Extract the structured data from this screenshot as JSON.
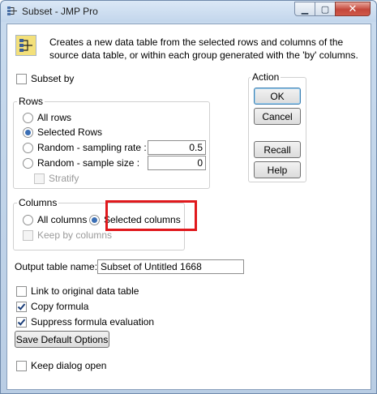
{
  "window": {
    "title": "Subset - JMP Pro",
    "minimize_glyph": "▁",
    "maximize_glyph": "▢",
    "close_glyph": "✕"
  },
  "info": {
    "text": "Creates a new data table from the selected rows and columns of the source data table, or within each group generated with the 'by' columns."
  },
  "subset_by": {
    "label": "Subset by",
    "checked": false
  },
  "rows": {
    "legend": "Rows",
    "all_rows": "All rows",
    "selected_rows": "Selected Rows",
    "random_rate": "Random - sampling rate :",
    "random_rate_value": "0.5",
    "random_size": "Random - sample size :",
    "random_size_value": "0",
    "stratify": "Stratify",
    "selected": "selected_rows"
  },
  "columns": {
    "legend": "Columns",
    "all_columns": "All columns",
    "selected_columns": "Selected columns",
    "keep_by_columns": "Keep by columns",
    "selected": "selected_columns"
  },
  "action": {
    "legend": "Action",
    "ok": "OK",
    "cancel": "Cancel",
    "recall": "Recall",
    "help": "Help"
  },
  "output": {
    "label": "Output table name:",
    "value": "Subset of Untitled 1668"
  },
  "options": {
    "link_original": {
      "label": "Link to original data table",
      "checked": false
    },
    "copy_formula": {
      "label": "Copy formula",
      "checked": true
    },
    "suppress_formula": {
      "label": "Suppress formula evaluation",
      "checked": true
    },
    "save_default": "Save Default Options",
    "keep_dialog_open": {
      "label": "Keep dialog open",
      "checked": false
    }
  },
  "colors": {
    "radio_dot": "#3b6fb5",
    "check_mark": "#1c3f7a",
    "highlight": "#e0191d"
  }
}
